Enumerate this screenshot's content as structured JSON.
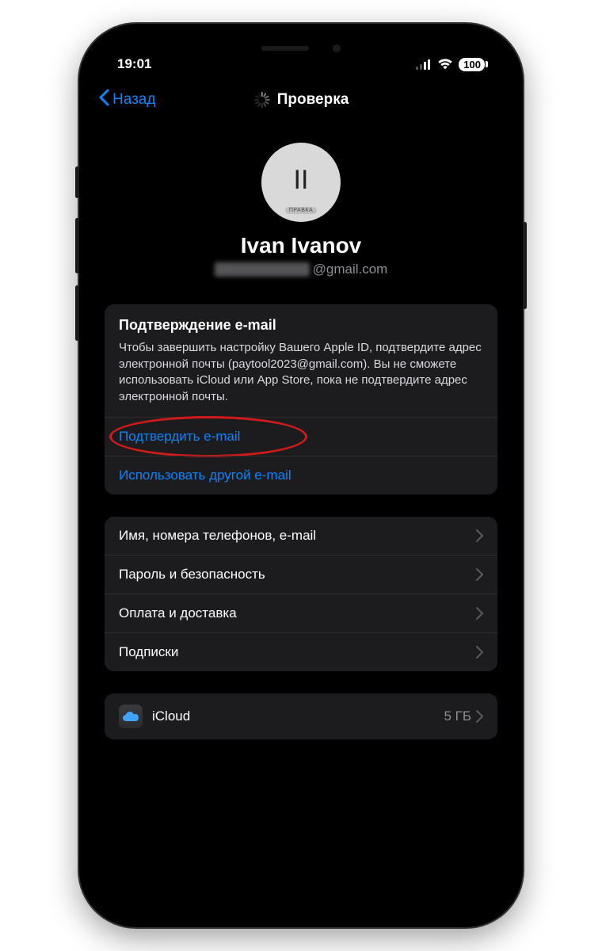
{
  "status": {
    "time": "19:01",
    "battery": "100"
  },
  "nav": {
    "back_label": "Назад",
    "title": "Проверка"
  },
  "profile": {
    "initials": "II",
    "edit_label": "ПРАВКА",
    "name": "Ivan Ivanov",
    "email_suffix": "@gmail.com"
  },
  "verify_card": {
    "title": "Подтверждение e-mail",
    "body": "Чтобы завершить настройку Вашего Apple ID, подтвердите адрес электронной почты (paytool2023@gmail.com). Вы не сможете использовать iCloud или App Store, пока не подтвердите адрес электронной почты.",
    "confirm_label": "Подтвердить e-mail",
    "use_other_label": "Использовать другой e-mail"
  },
  "settings": {
    "items": [
      {
        "label": "Имя, номера телефонов, e-mail"
      },
      {
        "label": "Пароль и безопасность"
      },
      {
        "label": "Оплата и доставка"
      },
      {
        "label": "Подписки"
      }
    ]
  },
  "icloud": {
    "label": "iCloud",
    "storage": "5 ГБ"
  },
  "colors": {
    "link": "#0a84ff",
    "highlight": "#d11a1a"
  }
}
